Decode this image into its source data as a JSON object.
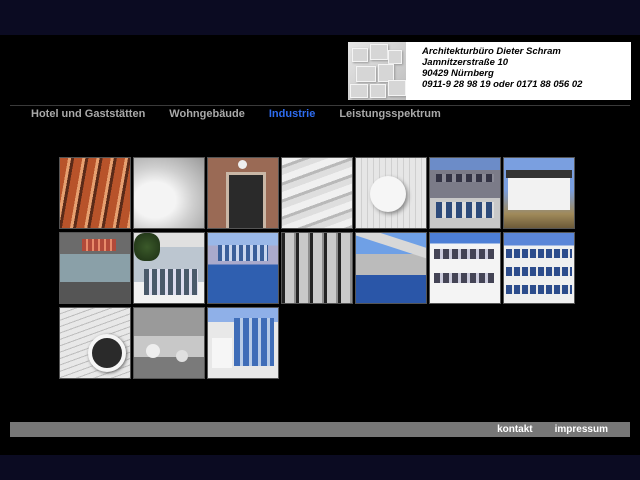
{
  "header": {
    "address_lines": [
      "Architekturbüro  Dieter Schram",
      "Jamnitzerstraße 10",
      "90429 Nürnberg",
      "0911-9 28 98 19  oder  0171 88 056 02"
    ]
  },
  "nav": {
    "items": [
      {
        "label": "Hotel und Gaststätten",
        "active": false
      },
      {
        "label": "Wohngebäude",
        "active": false
      },
      {
        "label": "Industrie",
        "active": true
      },
      {
        "label": "Leistungsspektrum",
        "active": false
      }
    ]
  },
  "gallery": {
    "count": 17,
    "thumbnails": [
      "orange-fins-facade",
      "white-curved-interior",
      "brick-entrance-clock",
      "white-sculpted-ceiling",
      "white-circle-wall",
      "gray-office-building",
      "white-house-blue-sky",
      "awning-facade",
      "glass-building-tree",
      "blue-rotunda",
      "glass-curtain-wall",
      "blue-curved-roof",
      "white-office-block",
      "blue-white-industrial",
      "porthole-window",
      "stone-wall-spheres",
      "glass-office-corner"
    ]
  },
  "footer": {
    "kontakt": "kontakt",
    "impressum": "impressum"
  },
  "colors": {
    "background": "#000000",
    "nav_text": "#a9a9a9",
    "nav_active": "#2e6cf0",
    "footer_bar": "#777777"
  }
}
